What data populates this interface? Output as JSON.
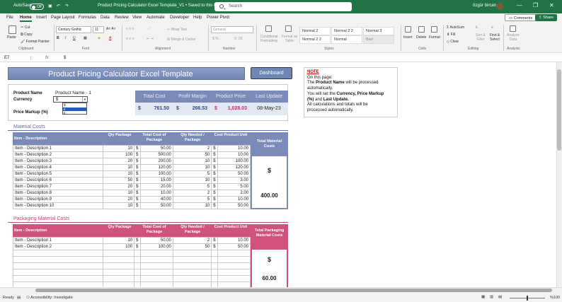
{
  "titlebar": {
    "autosave": "AutoSave",
    "autosave_state": "Off",
    "doc_title": "Product Pricing Calculator Excel Template_V1 • Saved to this PC",
    "search_placeholder": "Search",
    "user": "özgür bircan",
    "minimize": "—",
    "restore": "❐",
    "close": "✕"
  },
  "tabs": [
    "File",
    "Home",
    "Insert",
    "Page Layout",
    "Formulas",
    "Data",
    "Review",
    "View",
    "Automate",
    "Developer",
    "Help",
    "Power Pivot"
  ],
  "active_tab": "Home",
  "comments_label": "Comments",
  "share_label": "Share",
  "ribbon": {
    "paste": "Paste",
    "cut": "Cut",
    "copy": "Copy",
    "format_painter": "Format Painter",
    "clipboard": "Clipboard",
    "font_name": "Century Gothic",
    "font_size": "11",
    "font_group": "Font",
    "wrap_text": "Wrap Text",
    "merge_center": "Merge & Center",
    "alignment_group": "Alignment",
    "number_format": "General",
    "number_group": "Number",
    "conditional_formatting": "Conditional Formatting",
    "format_as_table": "Format as Table",
    "styles": [
      "Normal 2",
      "Normal 2 2",
      "Normal 3",
      "Normal 2 2",
      "Normal",
      "Bad"
    ],
    "styles_group": "Styles",
    "insert": "Insert",
    "delete": "Delete",
    "format": "Format",
    "cells_group": "Cells",
    "autosum": "AutoSum",
    "fill": "Fill",
    "clear": "Clear",
    "sort_filter": "Sort & Filter",
    "find_select": "Find & Select",
    "editing_group": "Editing",
    "analyze_data": "Analyze Data",
    "analysis_group": "Analysis"
  },
  "formula_bar": {
    "name_box": "E7",
    "fx": "fx",
    "content": "$"
  },
  "sheet": {
    "title": "Product Pricing Calculator Excel Template",
    "dashboard_button": "Dashboard",
    "note": {
      "heading": "NOTE",
      "line1": "On this page:",
      "line2_pre": "The ",
      "line2_bold": "Product Name",
      "line2_post": " will be processed",
      "line3": "automatically.",
      "line4_pre": "You will set the ",
      "line4_bold": "Currency, Price Markup",
      "line5_bold": "(%)",
      "line5_mid": " and ",
      "line5_bold2": "Last Update.",
      "line6": "All calculations and totals will be",
      "line7": "processed automatically."
    },
    "product_name_label": "Product Name",
    "product_name_value": "Product Name - 1",
    "currency_label": "Currency",
    "currency_value": "$",
    "currency_options": [
      "$",
      "€",
      "£"
    ],
    "price_markup_label": "Price Markup (%)",
    "summary": {
      "headers": [
        "Total Cost",
        "Profit Margin",
        "Product Price",
        "Last Update"
      ],
      "currency_symbol": "$",
      "total_cost": "761.50",
      "profit_margin": "266.53",
      "product_price": "1,028.03",
      "last_update": "08-May-23"
    },
    "material": {
      "title": "Material Costs",
      "headers": [
        "Item - Description",
        "Qty Package",
        "Total Cost of Package",
        "Qty Needed / Package",
        "Cost Product Unit",
        "Total Material Costs"
      ],
      "rows": [
        [
          "Item - Description 1",
          "10",
          "50.00",
          "2",
          "10.00"
        ],
        [
          "Item - Description 2",
          "100",
          "500.00",
          "50",
          "10.00"
        ],
        [
          "Item - Description 3",
          "20",
          "200.00",
          "10",
          "100.00"
        ],
        [
          "Item - Description 4",
          "10",
          "120.00",
          "10",
          "120.00"
        ],
        [
          "Item - Description 5",
          "10",
          "100.00",
          "5",
          "50.00"
        ],
        [
          "Item - Description 6",
          "50",
          "15.00",
          "10",
          "3.00"
        ],
        [
          "Item - Description 7",
          "20",
          "20.00",
          "5",
          "5.00"
        ],
        [
          "Item - Description 8",
          "10",
          "10.00",
          "2",
          "2.00"
        ],
        [
          "Item - Description 9",
          "20",
          "40.00",
          "5",
          "10.00"
        ],
        [
          "Item - Description 10",
          "10",
          "50.00",
          "10",
          "50.00"
        ]
      ],
      "currency_symbol": "$",
      "total_symbol": "$",
      "total_value": "400.00",
      "color": "#7b8bb8"
    },
    "packaging": {
      "title": "Packaging Material Costs",
      "headers": [
        "Item - Description",
        "Qty Package",
        "Total Cost of Package",
        "Qty Needed / Package",
        "Cost Product Unit",
        "Total Packaging Material Costs"
      ],
      "rows": [
        [
          "Item - Description 1",
          "10",
          "50.00",
          "2",
          "10.00"
        ],
        [
          "Item - Description 2",
          "100",
          "100.00",
          "50",
          "50.00"
        ]
      ],
      "empty_rows": 6,
      "currency_symbol": "$",
      "total_symbol": "$",
      "total_value": "60.00",
      "color": "#d1527a"
    }
  },
  "status": {
    "ready": "Ready",
    "accessibility": "Accessibility: Investigate",
    "zoom": "%100"
  }
}
